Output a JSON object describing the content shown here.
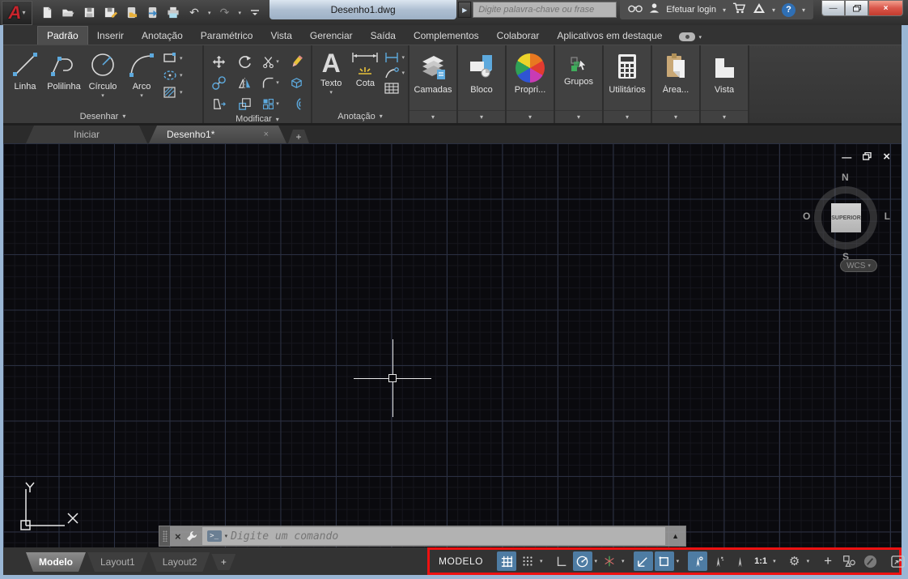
{
  "titlebar": {
    "app_initial": "A",
    "title": "Desenho1.dwg",
    "search_placeholder": "Digite palavra-chave ou frase",
    "login_label": "Efetuar login"
  },
  "icons": {
    "caret_down": "▾",
    "caret_up": "▲",
    "expand_right": "▶",
    "minimize": "—",
    "close": "×",
    "undo": "↶",
    "redo": "↷",
    "gear": "⚙",
    "hamburger": "≡",
    "plus_cross": "+",
    "question": "?",
    "tab_close": "×",
    "new_tab_plus": "+"
  },
  "ribbon": {
    "tabs": [
      {
        "label": "Padrão"
      },
      {
        "label": "Inserir"
      },
      {
        "label": "Anotação"
      },
      {
        "label": "Paramétrico"
      },
      {
        "label": "Vista"
      },
      {
        "label": "Gerenciar"
      },
      {
        "label": "Saída"
      },
      {
        "label": "Complementos"
      },
      {
        "label": "Colaborar"
      },
      {
        "label": "Aplicativos em destaque"
      }
    ],
    "draw_panel": {
      "title": "Desenhar",
      "buttons": [
        {
          "label": "Linha"
        },
        {
          "label": "Polilinha"
        },
        {
          "label": "Círculo"
        },
        {
          "label": "Arco"
        }
      ]
    },
    "modify_panel": {
      "title": "Modificar"
    },
    "annotation_panel": {
      "title": "Anotação",
      "buttons": [
        {
          "label": "Texto"
        },
        {
          "label": "Cota"
        }
      ]
    },
    "collapsed_panels": [
      {
        "label": "Camadas"
      },
      {
        "label": "Bloco"
      },
      {
        "label": "Propri..."
      },
      {
        "label": "Grupos"
      },
      {
        "label": "Utilitários"
      },
      {
        "label": "Área..."
      },
      {
        "label": "Vista"
      }
    ]
  },
  "file_tabs": {
    "items": [
      {
        "label": "Iniciar"
      },
      {
        "label": "Desenho1*"
      }
    ]
  },
  "viewport": {
    "viewcube": {
      "north": "N",
      "south": "S",
      "west": "O",
      "east": "L",
      "face": "SUPERIOR"
    },
    "wcs_label": "WCS"
  },
  "command_line": {
    "placeholder": "Digite um comando"
  },
  "bottom": {
    "layout_tabs": [
      {
        "label": "Modelo"
      },
      {
        "label": "Layout1"
      },
      {
        "label": "Layout2"
      }
    ],
    "status": {
      "model_label": "MODELO",
      "annotation_scale": "1:1"
    }
  },
  "colors": {
    "accent_blue": "#4aa3e8",
    "active_toggle_blue": "#4e7ca3",
    "highlight_red": "#ee1111",
    "canvas_background": "#0a0a0e",
    "window_border_blue": "#9ab6d4"
  }
}
